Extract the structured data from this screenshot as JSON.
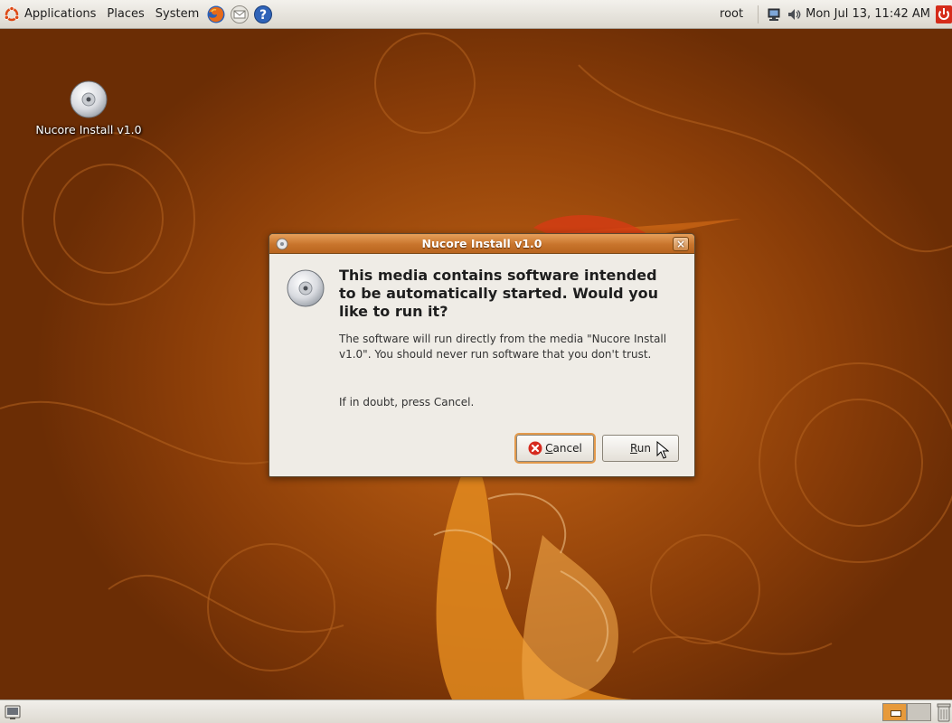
{
  "top_panel": {
    "menus": [
      "Applications",
      "Places",
      "System"
    ],
    "user": "root",
    "clock": "Mon Jul 13, 11:42 AM"
  },
  "desktop": {
    "icons": [
      {
        "label": "Nucore Install v1.0",
        "icon": "cd-icon"
      }
    ]
  },
  "dialog": {
    "title": "Nucore Install v1.0",
    "heading": "This media contains software intended to be automatically started. Would you like to run it?",
    "body": "The software will run directly from the media \"Nucore Install v1.0\". You should never run software that you don't trust.",
    "hint": "If in doubt, press Cancel.",
    "cancel_first": "C",
    "cancel_rest": "ancel",
    "run_first": "R",
    "run_rest": "un",
    "close_glyph": "×"
  },
  "bottom_panel": {
    "workspaces": 2,
    "active_workspace": 1
  },
  "colors": {
    "wallpaper": "#a9520f",
    "title_bar": "#c8742c",
    "focus_ring": "#e39a4c",
    "cancel_icon": "#d62a1f"
  }
}
